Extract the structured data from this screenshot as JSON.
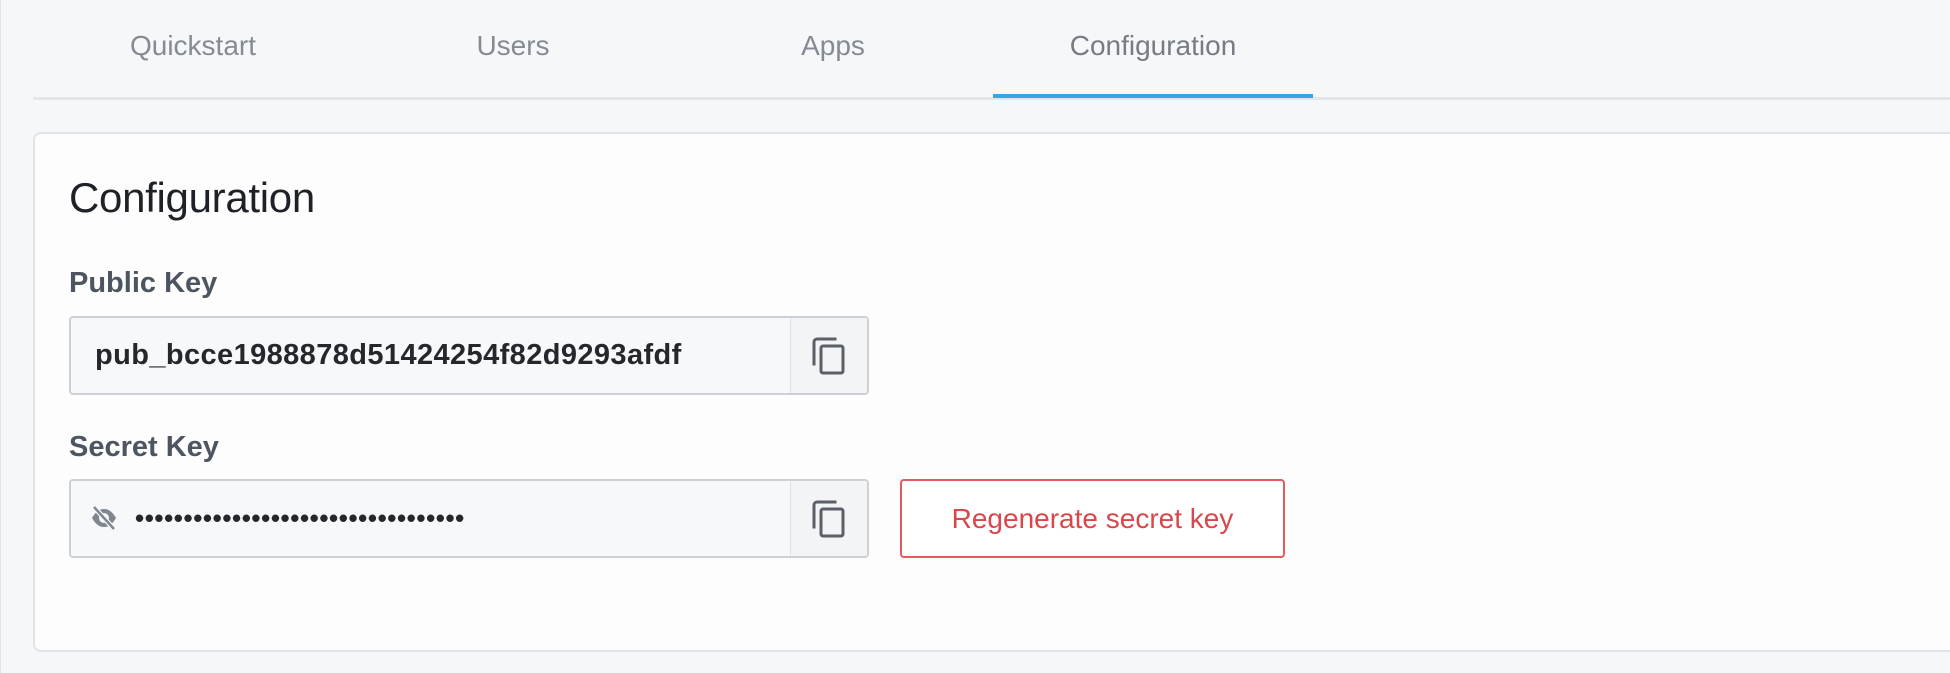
{
  "tabs": [
    {
      "label": "Quickstart",
      "active": false
    },
    {
      "label": "Users",
      "active": false
    },
    {
      "label": "Apps",
      "active": false
    },
    {
      "label": "Configuration",
      "active": true
    }
  ],
  "config": {
    "title": "Configuration",
    "public_key": {
      "label": "Public Key",
      "value": "pub_bcce1988878d51424254f82d9293afdf",
      "copy_icon": "copy-icon"
    },
    "secret_key": {
      "label": "Secret Key",
      "masked_value": "••••••••••••••••••••••••••••••••••",
      "visibility_icon": "eye-off-icon",
      "copy_icon": "copy-icon"
    },
    "regenerate_label": "Regenerate secret key"
  },
  "colors": {
    "accent": "#3aa3e3",
    "danger": "#d9474b",
    "background": "#f6f7f9"
  }
}
